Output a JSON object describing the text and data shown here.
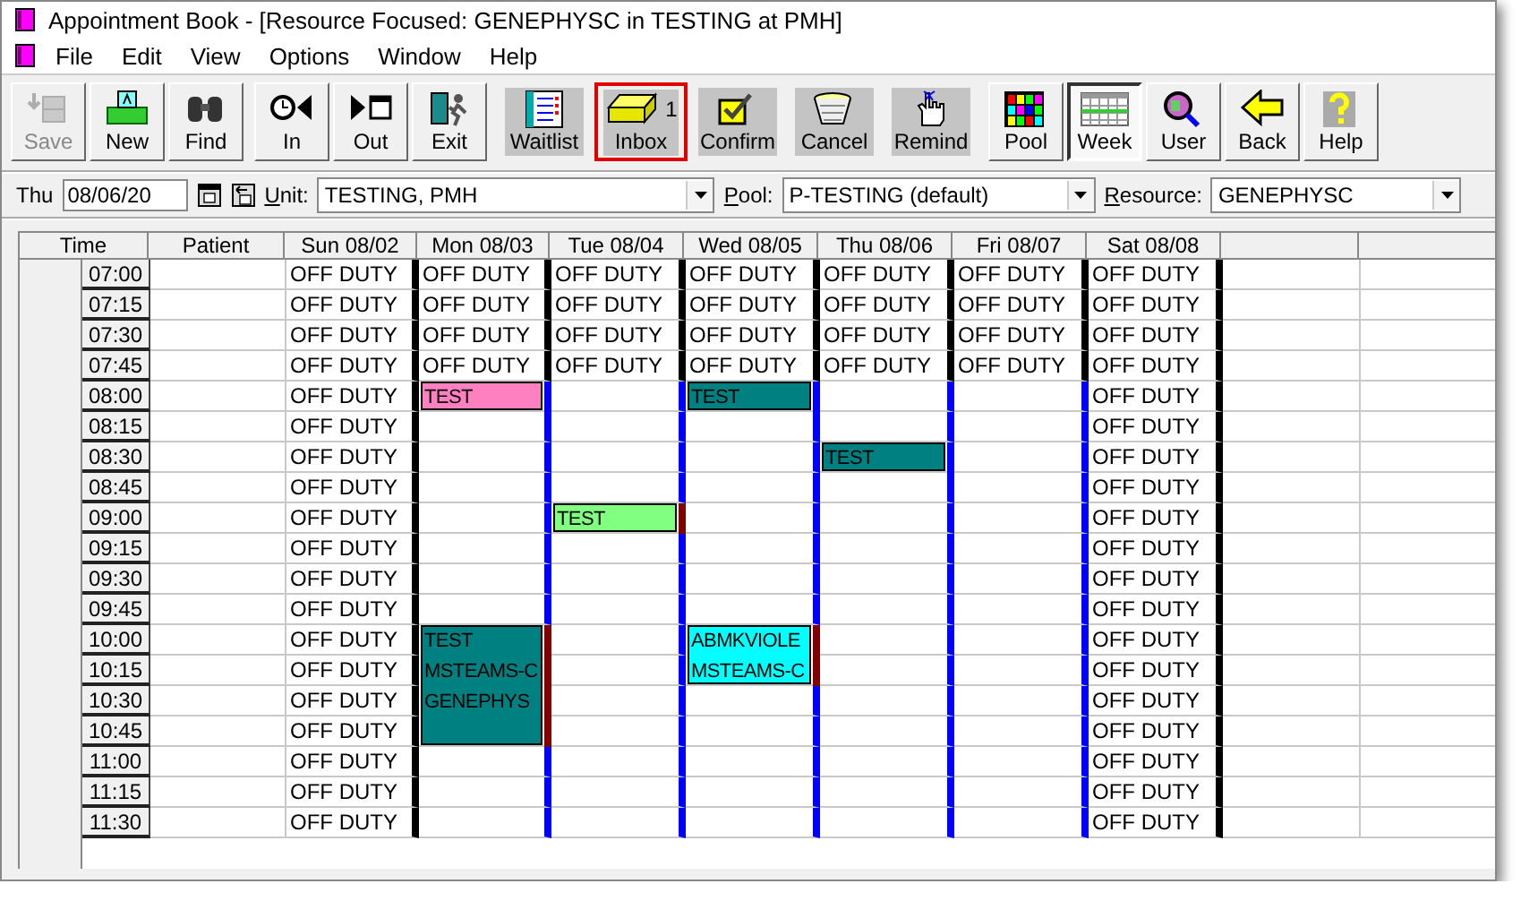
{
  "window": {
    "title": "Appointment Book - [Resource Focused:  GENEPHYSC in TESTING at PMH]"
  },
  "menu": {
    "items": [
      "File",
      "Edit",
      "View",
      "Options",
      "Window",
      "Help"
    ]
  },
  "toolbar": {
    "groups": [
      {
        "buttons": [
          {
            "label": "Save",
            "kind": "raised",
            "disabled": true,
            "pressed": false,
            "highlighted": false
          },
          {
            "label": "New",
            "kind": "raised",
            "disabled": false,
            "pressed": false,
            "highlighted": false
          },
          {
            "label": "Find",
            "kind": "raised",
            "disabled": false,
            "pressed": false,
            "highlighted": false
          }
        ]
      },
      {
        "buttons": [
          {
            "label": "In",
            "kind": "raised",
            "disabled": false,
            "pressed": false,
            "highlighted": false
          },
          {
            "label": "Out",
            "kind": "raised",
            "disabled": false,
            "pressed": false,
            "highlighted": false
          },
          {
            "label": "Exit",
            "kind": "raised",
            "disabled": false,
            "pressed": false,
            "highlighted": false
          }
        ]
      },
      {
        "buttons": [
          {
            "label": "Waitlist",
            "kind": "flat",
            "disabled": false,
            "pressed": false,
            "highlighted": false
          },
          {
            "label": "Inbox",
            "kind": "flat",
            "disabled": false,
            "pressed": false,
            "highlighted": true,
            "badge": "1"
          },
          {
            "label": "Confirm",
            "kind": "flat",
            "disabled": false,
            "pressed": false,
            "highlighted": false
          },
          {
            "label": "Cancel",
            "kind": "flat",
            "disabled": false,
            "pressed": false,
            "highlighted": false
          },
          {
            "label": "Remind",
            "kind": "flat",
            "disabled": false,
            "pressed": false,
            "highlighted": false
          }
        ]
      },
      {
        "buttons": [
          {
            "label": "Pool",
            "kind": "raised",
            "disabled": false,
            "pressed": false,
            "highlighted": false
          },
          {
            "label": "Week",
            "kind": "raised",
            "disabled": false,
            "pressed": true,
            "highlighted": false
          },
          {
            "label": "User",
            "kind": "raised",
            "disabled": false,
            "pressed": false,
            "highlighted": false
          },
          {
            "label": "Back",
            "kind": "raised",
            "disabled": false,
            "pressed": false,
            "highlighted": false
          },
          {
            "label": "Help",
            "kind": "raised",
            "disabled": false,
            "pressed": false,
            "highlighted": false
          }
        ]
      }
    ]
  },
  "filters": {
    "day": "Thu",
    "date": "08/06/20",
    "unit": {
      "label": "Unit:",
      "value": "TESTING, PMH"
    },
    "pool": {
      "label": "Pool:",
      "value": "P-TESTING (default)"
    },
    "resource": {
      "label": "Resource:",
      "value": "GENEPHYSC"
    }
  },
  "schedule": {
    "columns": [
      "Time",
      "Patient",
      "Sun 08/02",
      "Mon 08/03",
      "Tue 08/04",
      "Wed 08/05",
      "Thu 08/06",
      "Fri 08/07",
      "Sat 08/08"
    ],
    "times": [
      "07:00",
      "07:15",
      "07:30",
      "07:45",
      "08:00",
      "08:15",
      "08:30",
      "08:45",
      "09:00",
      "09:15",
      "09:30",
      "09:45",
      "10:00",
      "10:15",
      "10:30",
      "10:45",
      "11:00",
      "11:15",
      "11:30"
    ],
    "days": [
      {
        "cells": [
          {
            "kind": "off",
            "text": "OFF DUTY"
          },
          {
            "kind": "off",
            "text": "OFF DUTY"
          },
          {
            "kind": "off",
            "text": "OFF DUTY"
          },
          {
            "kind": "off",
            "text": "OFF DUTY"
          },
          {
            "kind": "off",
            "text": "OFF DUTY"
          },
          {
            "kind": "off",
            "text": "OFF DUTY"
          },
          {
            "kind": "off",
            "text": "OFF DUTY"
          },
          {
            "kind": "off",
            "text": "OFF DUTY"
          },
          {
            "kind": "off",
            "text": "OFF DUTY"
          },
          {
            "kind": "off",
            "text": "OFF DUTY"
          },
          {
            "kind": "off",
            "text": "OFF DUTY"
          },
          {
            "kind": "off",
            "text": "OFF DUTY"
          },
          {
            "kind": "off",
            "text": "OFF DUTY"
          },
          {
            "kind": "off",
            "text": "OFF DUTY"
          },
          {
            "kind": "off",
            "text": "OFF DUTY"
          },
          {
            "kind": "off",
            "text": "OFF DUTY"
          },
          {
            "kind": "off",
            "text": "OFF DUTY"
          },
          {
            "kind": "off",
            "text": "OFF DUTY"
          },
          {
            "kind": "off",
            "text": "OFF DUTY"
          }
        ]
      },
      {
        "cells": [
          {
            "kind": "off",
            "text": "OFF DUTY"
          },
          {
            "kind": "off",
            "text": "OFF DUTY"
          },
          {
            "kind": "off",
            "text": "OFF DUTY"
          },
          {
            "kind": "off",
            "text": "OFF DUTY"
          },
          {
            "kind": "appointment",
            "appointment": {
              "lines": [
                "TEST"
              ],
              "color": "#ff80c0"
            },
            "slots": [
              {
                "flagged": false
              }
            ]
          },
          {
            "kind": "open",
            "flagged": false
          },
          {
            "kind": "open",
            "flagged": false
          },
          {
            "kind": "open",
            "flagged": false
          },
          {
            "kind": "open",
            "flagged": false
          },
          {
            "kind": "open",
            "flagged": false
          },
          {
            "kind": "open",
            "flagged": false
          },
          {
            "kind": "open",
            "flagged": false
          },
          {
            "kind": "appointment",
            "appointment": {
              "lines": [
                "TEST",
                "MSTEAMS-C",
                "GENEPHYS"
              ],
              "color": "#008080"
            },
            "slots": [
              {
                "flagged": true
              },
              {
                "flagged": true
              },
              {
                "flagged": true
              },
              {
                "flagged": true
              }
            ]
          },
          {
            "kind": "open",
            "flagged": false
          },
          {
            "kind": "open",
            "flagged": false
          },
          {
            "kind": "open",
            "flagged": false
          }
        ]
      },
      {
        "cells": [
          {
            "kind": "off",
            "text": "OFF DUTY"
          },
          {
            "kind": "off",
            "text": "OFF DUTY"
          },
          {
            "kind": "off",
            "text": "OFF DUTY"
          },
          {
            "kind": "off",
            "text": "OFF DUTY"
          },
          {
            "kind": "open",
            "flagged": false
          },
          {
            "kind": "open",
            "flagged": false
          },
          {
            "kind": "open",
            "flagged": false
          },
          {
            "kind": "open",
            "flagged": false
          },
          {
            "kind": "appointment",
            "appointment": {
              "lines": [
                "TEST"
              ],
              "color": "#80ff80"
            },
            "slots": [
              {
                "flagged": true
              }
            ]
          },
          {
            "kind": "open",
            "flagged": false
          },
          {
            "kind": "open",
            "flagged": false
          },
          {
            "kind": "open",
            "flagged": false
          },
          {
            "kind": "open",
            "flagged": false
          },
          {
            "kind": "open",
            "flagged": false
          },
          {
            "kind": "open",
            "flagged": false
          },
          {
            "kind": "open",
            "flagged": false
          },
          {
            "kind": "open",
            "flagged": false
          },
          {
            "kind": "open",
            "flagged": false
          },
          {
            "kind": "open",
            "flagged": false
          }
        ]
      },
      {
        "cells": [
          {
            "kind": "off",
            "text": "OFF DUTY"
          },
          {
            "kind": "off",
            "text": "OFF DUTY"
          },
          {
            "kind": "off",
            "text": "OFF DUTY"
          },
          {
            "kind": "off",
            "text": "OFF DUTY"
          },
          {
            "kind": "appointment",
            "appointment": {
              "lines": [
                "TEST"
              ],
              "color": "#008080"
            },
            "slots": [
              {
                "flagged": false
              }
            ]
          },
          {
            "kind": "open",
            "flagged": false
          },
          {
            "kind": "open",
            "flagged": false
          },
          {
            "kind": "open",
            "flagged": false
          },
          {
            "kind": "open",
            "flagged": false
          },
          {
            "kind": "open",
            "flagged": false
          },
          {
            "kind": "open",
            "flagged": false
          },
          {
            "kind": "open",
            "flagged": false
          },
          {
            "kind": "appointment",
            "appointment": {
              "lines": [
                "ABMKVIOLE",
                "MSTEAMS-C"
              ],
              "color": "#00ffff"
            },
            "slots": [
              {
                "flagged": true
              },
              {
                "flagged": true
              }
            ]
          },
          {
            "kind": "open",
            "flagged": false
          },
          {
            "kind": "open",
            "flagged": false
          },
          {
            "kind": "open",
            "flagged": false
          },
          {
            "kind": "open",
            "flagged": false
          },
          {
            "kind": "open",
            "flagged": false
          }
        ]
      },
      {
        "cells": [
          {
            "kind": "off",
            "text": "OFF DUTY"
          },
          {
            "kind": "off",
            "text": "OFF DUTY"
          },
          {
            "kind": "off",
            "text": "OFF DUTY"
          },
          {
            "kind": "off",
            "text": "OFF DUTY"
          },
          {
            "kind": "open",
            "flagged": false
          },
          {
            "kind": "open",
            "flagged": false
          },
          {
            "kind": "appointment",
            "appointment": {
              "lines": [
                "TEST"
              ],
              "color": "#008080"
            },
            "slots": [
              {
                "flagged": false
              }
            ]
          },
          {
            "kind": "open",
            "flagged": false
          },
          {
            "kind": "open",
            "flagged": false
          },
          {
            "kind": "open",
            "flagged": false
          },
          {
            "kind": "open",
            "flagged": false
          },
          {
            "kind": "open",
            "flagged": false
          },
          {
            "kind": "open",
            "flagged": false
          },
          {
            "kind": "open",
            "flagged": false
          },
          {
            "kind": "open",
            "flagged": false
          },
          {
            "kind": "open",
            "flagged": false
          },
          {
            "kind": "open",
            "flagged": false
          },
          {
            "kind": "open",
            "flagged": false
          },
          {
            "kind": "open",
            "flagged": false
          }
        ]
      },
      {
        "cells": [
          {
            "kind": "off",
            "text": "OFF DUTY"
          },
          {
            "kind": "off",
            "text": "OFF DUTY"
          },
          {
            "kind": "off",
            "text": "OFF DUTY"
          },
          {
            "kind": "off",
            "text": "OFF DUTY"
          },
          {
            "kind": "open",
            "flagged": false
          },
          {
            "kind": "open",
            "flagged": false
          },
          {
            "kind": "open",
            "flagged": false
          },
          {
            "kind": "open",
            "flagged": false
          },
          {
            "kind": "open",
            "flagged": false
          },
          {
            "kind": "open",
            "flagged": false
          },
          {
            "kind": "open",
            "flagged": false
          },
          {
            "kind": "open",
            "flagged": false
          },
          {
            "kind": "open",
            "flagged": false
          },
          {
            "kind": "open",
            "flagged": false
          },
          {
            "kind": "open",
            "flagged": false
          },
          {
            "kind": "open",
            "flagged": false
          },
          {
            "kind": "open",
            "flagged": false
          },
          {
            "kind": "open",
            "flagged": false
          },
          {
            "kind": "open",
            "flagged": false
          }
        ]
      },
      {
        "cells": [
          {
            "kind": "off",
            "text": "OFF DUTY"
          },
          {
            "kind": "off",
            "text": "OFF DUTY"
          },
          {
            "kind": "off",
            "text": "OFF DUTY"
          },
          {
            "kind": "off",
            "text": "OFF DUTY"
          },
          {
            "kind": "off",
            "text": "OFF DUTY"
          },
          {
            "kind": "off",
            "text": "OFF DUTY"
          },
          {
            "kind": "off",
            "text": "OFF DUTY"
          },
          {
            "kind": "off",
            "text": "OFF DUTY"
          },
          {
            "kind": "off",
            "text": "OFF DUTY"
          },
          {
            "kind": "off",
            "text": "OFF DUTY"
          },
          {
            "kind": "off",
            "text": "OFF DUTY"
          },
          {
            "kind": "off",
            "text": "OFF DUTY"
          },
          {
            "kind": "off",
            "text": "OFF DUTY"
          },
          {
            "kind": "off",
            "text": "OFF DUTY"
          },
          {
            "kind": "off",
            "text": "OFF DUTY"
          },
          {
            "kind": "off",
            "text": "OFF DUTY"
          },
          {
            "kind": "off",
            "text": "OFF DUTY"
          },
          {
            "kind": "off",
            "text": "OFF DUTY"
          },
          {
            "kind": "off",
            "text": "OFF DUTY"
          }
        ]
      }
    ]
  }
}
